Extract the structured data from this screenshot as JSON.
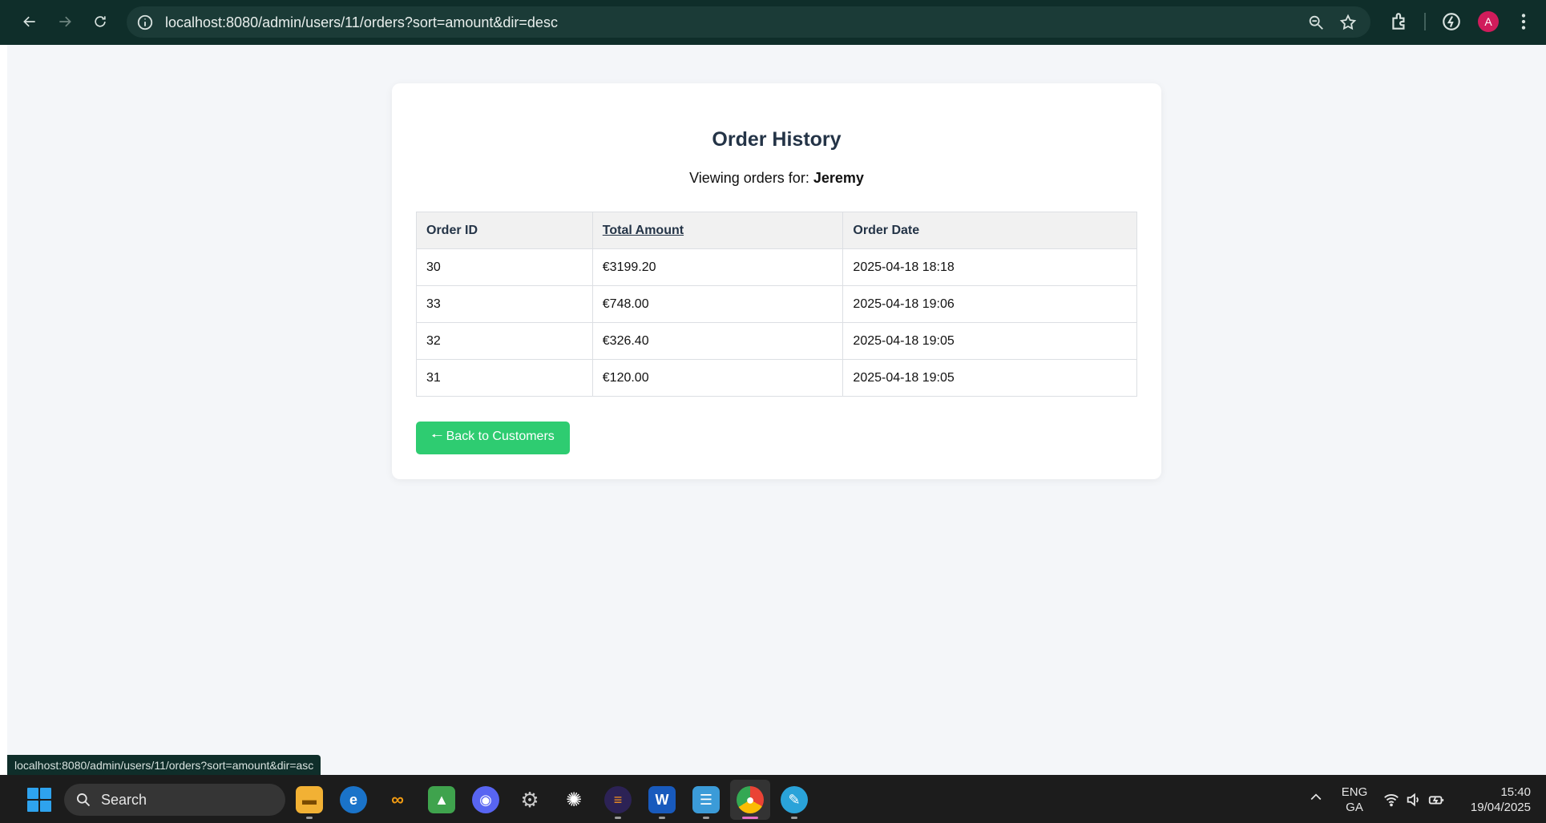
{
  "browser": {
    "url": "localhost:8080/admin/users/11/orders?sort=amount&dir=desc",
    "profile_initial": "A",
    "status_url": "localhost:8080/admin/users/11/orders?sort=amount&dir=asc"
  },
  "page": {
    "title": "Order History",
    "viewing_prefix": "Viewing orders for:",
    "customer_name": "Jeremy",
    "table": {
      "headers": [
        "Order ID",
        "Total Amount",
        "Order Date"
      ],
      "rows": [
        [
          "30",
          "€3199.20",
          "2025-04-18 18:18"
        ],
        [
          "33",
          "€748.00",
          "2025-04-18 19:06"
        ],
        [
          "32",
          "€326.40",
          "2025-04-18 19:05"
        ],
        [
          "31",
          "€120.00",
          "2025-04-18 19:05"
        ]
      ]
    },
    "back_button": "🠐 Back to Customers"
  },
  "taskbar": {
    "search_label": "Search",
    "lang_line1": "ENG",
    "lang_line2": "GA",
    "time": "15:40",
    "date": "19/04/2025"
  },
  "colors": {
    "accent_green": "#2ecc71",
    "heading": "#243447",
    "chrome_bg": "#0f2e2a"
  }
}
